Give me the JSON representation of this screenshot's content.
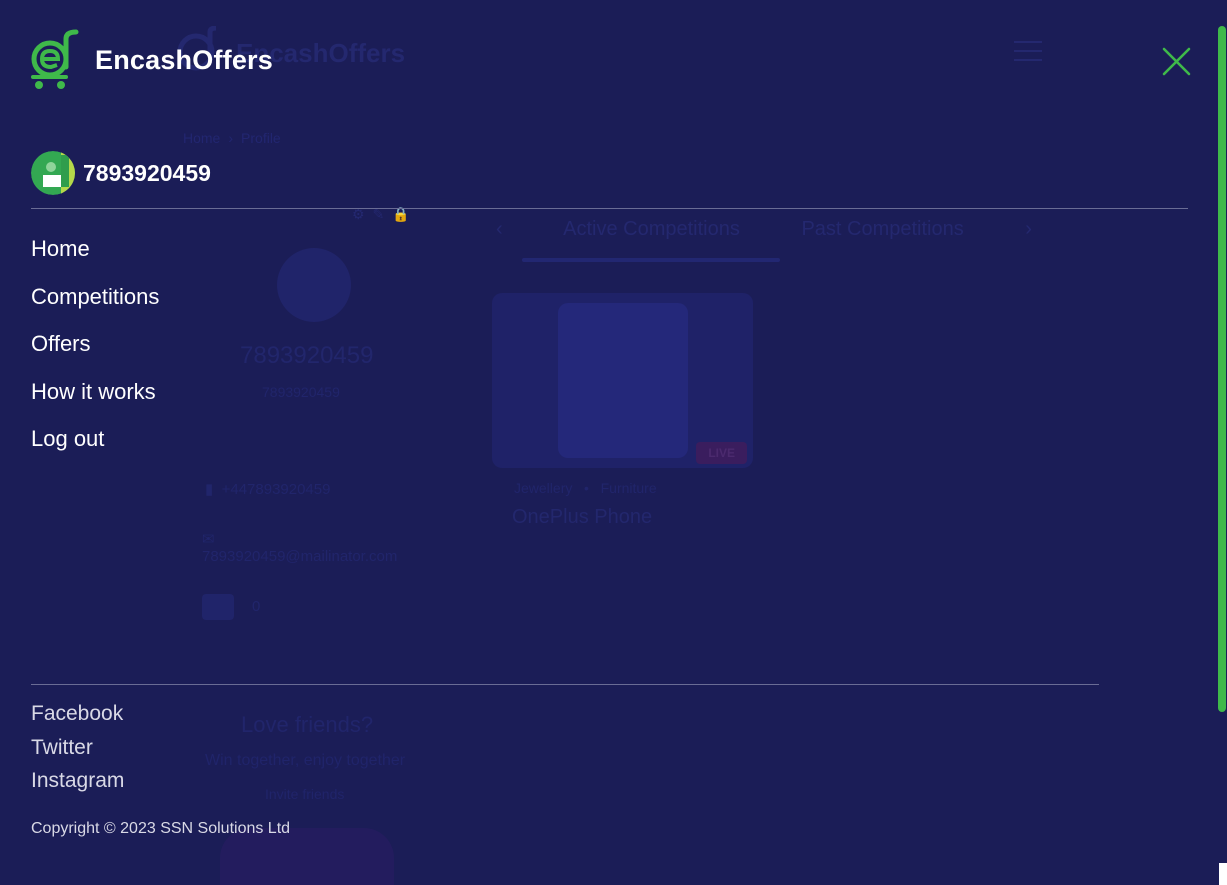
{
  "brand": {
    "name": "EncashOffers",
    "logo_icon": "encash-cart-logo"
  },
  "user": {
    "phone": "7893920459",
    "avatar_icon": "user-avatar"
  },
  "close_icon": "close-x-icon",
  "nav": [
    {
      "label": "Home"
    },
    {
      "label": "Competitions"
    },
    {
      "label": "Offers"
    },
    {
      "label": "How it works"
    },
    {
      "label": "Log out"
    }
  ],
  "social": [
    {
      "label": "Facebook"
    },
    {
      "label": "Twitter"
    },
    {
      "label": "Instagram"
    }
  ],
  "copyright": "Copyright © 2023 SSN Solutions Ltd",
  "background_page": {
    "logo_text": "EncashOffers",
    "breadcrumb": {
      "home": "Home",
      "separator": "›",
      "current": "Profile"
    },
    "profile": {
      "phone": "7893920459",
      "username": "7893920459",
      "phone_full": "+447893920459",
      "email": "7893920459@mailinator.com",
      "coins": "0"
    },
    "tabs": {
      "active": "Active Competitions",
      "past": "Past Competitions"
    },
    "card": {
      "badge": "LIVE",
      "category_1": "Jewellery",
      "category_separator": "•",
      "category_2": "Furniture",
      "title": "OnePlus Phone"
    },
    "promo": {
      "title": "Love friends?",
      "subtitle": "Win together, enjoy together",
      "cta": "Invite friends"
    }
  },
  "colors": {
    "overlay_bg": "#1b1d57",
    "accent_green": "#3fb94a",
    "text_white": "#ffffff",
    "divider": "#6a6c95"
  }
}
